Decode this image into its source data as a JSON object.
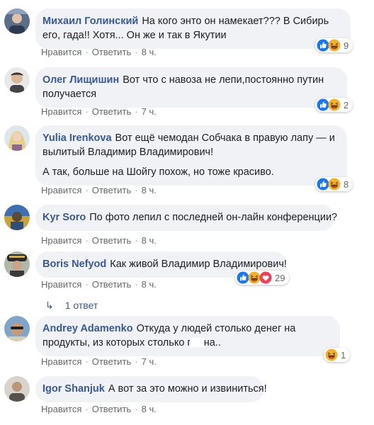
{
  "actions": {
    "like": "Нравится",
    "reply": "Ответить"
  },
  "comments": [
    {
      "author": "Михаил Голинский",
      "text": "На кого энто он намекает??? В Сибирь его, гада!! Хотя... Он же и так в Якутии",
      "time": "8 ч.",
      "reactions": [
        "like-icon",
        "haha-icon"
      ],
      "count": "9"
    },
    {
      "author": "Олег Лищишин",
      "text": "Вот что с навоза не лепи,постоянно путин получается",
      "time": "7 ч.",
      "reactions": [
        "like-icon",
        "haha-icon"
      ],
      "count": "2"
    },
    {
      "author": "Yulia Irenkova",
      "text": "Вот ещё чемодан Собчака в правую лапу — и вылитый Владимир Владимирович!",
      "text2": "А так, больше на Шойгу похож, но тоже красиво.",
      "time": "8 ч.",
      "reactions": [
        "like-icon",
        "haha-icon"
      ],
      "count": "8"
    },
    {
      "author": "Kyr Soro",
      "text": "По фото лепил с последней он-лайн конференции?",
      "time": "8 ч."
    },
    {
      "author": "Boris Nefyod",
      "text": "Как живой Владимир Владимирович!",
      "time": "8 ч.",
      "reactions": [
        "like-icon",
        "haha-icon",
        "love-icon"
      ],
      "count": "29",
      "replies": "1 ответ"
    },
    {
      "author": "Andrey Adamenko",
      "text_a": "Откуда у людей столько денег на продукты, из которых столько г",
      "text_b": "на..",
      "time": "7 ч.",
      "reactions": [
        "haha-icon"
      ],
      "count": "1"
    },
    {
      "author": "Igor Shanjuk",
      "text": "А вот за это можно и извиниться!",
      "time": "8 ч."
    }
  ],
  "colors": {
    "author": "#385898",
    "bubble": "#f0f2f5",
    "meta": "#65676b",
    "like": "#1877f2",
    "haha": "#f7b125",
    "love": "#f33e58"
  }
}
